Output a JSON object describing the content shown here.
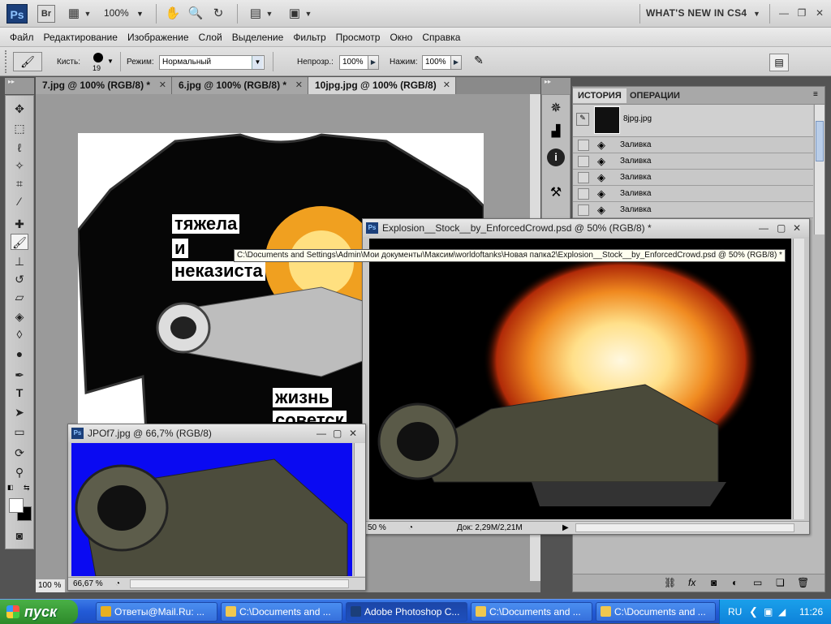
{
  "app": {
    "logo": "Ps",
    "bridge": "Br",
    "zoom": "100%",
    "workspace": "WHAT'S NEW IN CS4"
  },
  "menu": [
    "Файл",
    "Редактирование",
    "Изображение",
    "Слой",
    "Выделение",
    "Фильтр",
    "Просмотр",
    "Окно",
    "Справка"
  ],
  "options": {
    "brush_label": "Кисть:",
    "brush_size": "19",
    "mode_label": "Режим:",
    "mode_value": "Нормальный",
    "opacity_label": "Непрозр.:",
    "opacity_value": "100%",
    "flow_label": "Нажим:",
    "flow_value": "100%"
  },
  "tabs": [
    {
      "label": "7.jpg @ 100% (RGB/8) *"
    },
    {
      "label": "6.jpg @ 100% (RGB/8) *"
    },
    {
      "label": "10jpg.jpg @ 100% (RGB/8)"
    }
  ],
  "canvas": {
    "zoom": "100 %",
    "shirt_text_1": "тяжела",
    "shirt_text_2": "и",
    "shirt_text_3": "неказиста",
    "shirt_text_4": "жизнь",
    "shirt_text_5": "советск"
  },
  "panel": {
    "tab_history": "ИСТОРИЯ",
    "tab_actions": "ОПЕРАЦИИ",
    "snapshot": "8jpg.jpg",
    "rows": [
      "Заливка",
      "Заливка",
      "Заливка",
      "Заливка",
      "Заливка"
    ]
  },
  "docs": {
    "explosion": {
      "title": "Explosion__Stock__by_EnforcedCrowd.psd @ 50% (RGB/8) *",
      "zoom": "50 %",
      "doc_size": "Док: 2,29M/2,21M"
    },
    "jpof7": {
      "title": "JPOf7.jpg @ 66,7% (RGB/8)",
      "zoom": "66,67 %"
    }
  },
  "tooltip": "C:\\Documents and Settings\\Admin\\Мои документы\\Максим\\worldoftanks\\Новая папка2\\Explosion__Stock__by_EnforcedCrowd.psd @ 50% (RGB/8) *",
  "taskbar": {
    "start": "пуск",
    "tasks": [
      {
        "label": "Ответы@Mail.Ru: ...",
        "color": "#e8b020"
      },
      {
        "label": "C:\\Documents and ...",
        "color": "#f0c850"
      },
      {
        "label": "Adobe Photoshop C...",
        "color": "#1b3f7a"
      },
      {
        "label": "C:\\Documents and ...",
        "color": "#f0c850"
      },
      {
        "label": "C:\\Documents and ...",
        "color": "#f0c850"
      }
    ],
    "lang": "RU",
    "time": "11:26"
  }
}
